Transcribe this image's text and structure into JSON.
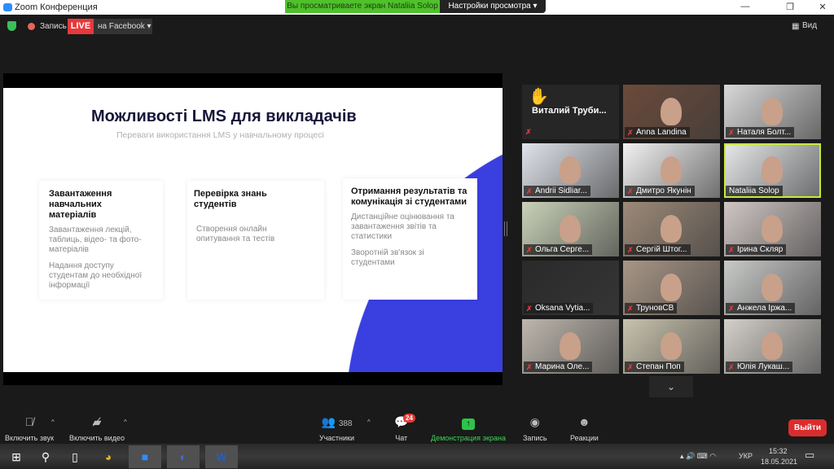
{
  "window": {
    "title": "Zoom Конференция",
    "banner": "Вы просматриваете экран Nataliia Solop",
    "view_settings": "Настройки просмотра ▾"
  },
  "topbar": {
    "record": "Запись",
    "live": "LIVE",
    "facebook": "на Facebook ▾",
    "view": "Вид"
  },
  "slide": {
    "title": "Можливості LMS для викладачів",
    "subtitle": "Переваги використання LMS у навчальному процесі",
    "cards": [
      {
        "heading": "Завантаження навчальних матеріалів",
        "paras": [
          "Завантаження лекцій, таблиць, відео- та фото- матеріалів",
          "Надання доступу студентам до необхідної інформації"
        ]
      },
      {
        "heading": "Перевірка знань студентів",
        "paras": [
          "Створення онлайн опитування та тестів"
        ]
      },
      {
        "heading": "Отримання результатів та комунікація зі студентами",
        "paras": [
          "Дистанційне оцінювання та завантаження звітів та статистики",
          "Зворотній зв'язок зі студентами"
        ]
      }
    ],
    "accent": "#3a3fe0"
  },
  "participants": [
    {
      "name": "Виталий  Труби...",
      "hand": true,
      "bg": "#262626"
    },
    {
      "name": "Anna Landina",
      "bg": "#6b4a3a"
    },
    {
      "name": "Наталя Болт...",
      "bg": "#d8d8d8"
    },
    {
      "name": "Andrii Sidliar...",
      "bg": "#dfe3ea"
    },
    {
      "name": "Дмитро Якунін",
      "bg": "#f2f2f2"
    },
    {
      "name": "Nataliia Solop",
      "bg": "#e6e8ea",
      "active": true
    },
    {
      "name": "Ольга Серге...",
      "bg": "#c9d1b8"
    },
    {
      "name": "Сергій Штог...",
      "bg": "#9c8a78"
    },
    {
      "name": "Ірина Скляр",
      "bg": "#cfc6c4"
    },
    {
      "name": "Oksana Vytia...",
      "bg": "#2a2a2a"
    },
    {
      "name": "ТруновСВ",
      "bg": "#a89686"
    },
    {
      "name": "Анжела Іржа...",
      "bg": "#c8cac8"
    },
    {
      "name": "Марина Оле...",
      "bg": "#bdb6ad"
    },
    {
      "name": "Степан Поп",
      "bg": "#c8c2ad"
    },
    {
      "name": "Юлія Лукаш...",
      "bg": "#d4d0cb"
    }
  ],
  "toolbar": {
    "unmute": "Включить звук",
    "video": "Включить видео",
    "participants": "Участники",
    "count": "388",
    "chat": "Чат",
    "chat_badge": "24",
    "share": "Демонстрация экрана",
    "record": "Запись",
    "reactions": "Реакции",
    "leave": "Выйти"
  },
  "taskbar": {
    "lang": "УКР",
    "time": "15:32",
    "date": "18.05.2021"
  }
}
